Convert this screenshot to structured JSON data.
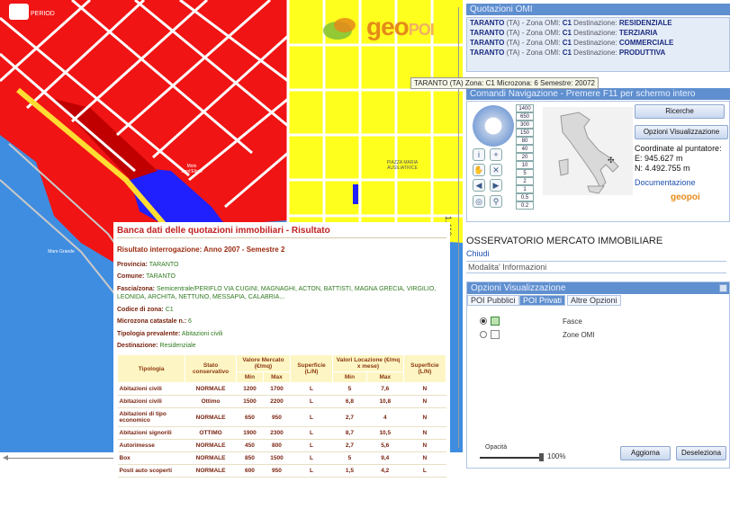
{
  "map": {
    "label_sea": "Mare Grande",
    "label_square": "PIAZZA MARIA AUSILIATRICE",
    "label_street": "Molo Sant'Eligio",
    "topleft_text": "PERIOD"
  },
  "logo": {
    "main": "geo",
    "suffix": "POI"
  },
  "scale_text": "1.410 m",
  "result": {
    "title": "Banca dati delle quotazioni immobiliari - Risultato",
    "subtitle": "Risultato interrogazione: Anno 2007 - Semestre 2",
    "fields": [
      {
        "label": "Provincia:",
        "value": "TARANTO"
      },
      {
        "label": "Comune:",
        "value": "TARANTO"
      },
      {
        "label": "Fascia/zona:",
        "value": "Semicentrale/PERIFLO VIA CUGINI, MAGNAGHI, ACTON, BATTISTI, MAGNA GRECIA, VIRGILIO, LEONIDA, ARCHITA, NETTUNO, MESSAPIA, CALABRIA..."
      },
      {
        "label": "Codice di zona:",
        "value": "C1"
      },
      {
        "label": "Microzona catastale n.:",
        "value": "6"
      },
      {
        "label": "Tipologia prevalente:",
        "value": "Abitazioni civili"
      },
      {
        "label": "Destinazione:",
        "value": "Residenziale"
      }
    ],
    "table": {
      "headers": {
        "tipologia": "Tipologia",
        "stato": "Stato conservativo",
        "valore_mercato": "Valore Mercato (€/mq)",
        "sup1": "Superficie (L/N)",
        "valori_locazione": "Valori Locazione (€/mq x mese)",
        "sup2": "Superficie (L/N)",
        "min": "Min",
        "max": "Max"
      },
      "rows": [
        {
          "tipologia": "Abitazioni civili",
          "stato": "NORMALE",
          "vmin": "1200",
          "vmax": "1700",
          "s1": "L",
          "lmin": "5",
          "lmax": "7,6",
          "s2": "N"
        },
        {
          "tipologia": "Abitazioni civili",
          "stato": "Ottimo",
          "vmin": "1500",
          "vmax": "2200",
          "s1": "L",
          "lmin": "6,8",
          "lmax": "10,8",
          "s2": "N"
        },
        {
          "tipologia": "Abitazioni di tipo economico",
          "stato": "NORMALE",
          "vmin": "650",
          "vmax": "950",
          "s1": "L",
          "lmin": "2,7",
          "lmax": "4",
          "s2": "N"
        },
        {
          "tipologia": "Abitazioni signorili",
          "stato": "OTTIMO",
          "vmin": "1900",
          "vmax": "2300",
          "s1": "L",
          "lmin": "8,7",
          "lmax": "10,5",
          "s2": "N"
        },
        {
          "tipologia": "Autorimesse",
          "stato": "NORMALE",
          "vmin": "450",
          "vmax": "800",
          "s1": "L",
          "lmin": "2,7",
          "lmax": "5,6",
          "s2": "N"
        },
        {
          "tipologia": "Box",
          "stato": "NORMALE",
          "vmin": "850",
          "vmax": "1500",
          "s1": "L",
          "lmin": "5",
          "lmax": "9,4",
          "s2": "N"
        },
        {
          "tipologia": "Posti auto scoperti",
          "stato": "NORMALE",
          "vmin": "600",
          "vmax": "950",
          "s1": "L",
          "lmin": "1,5",
          "lmax": "4,2",
          "s2": "L"
        }
      ]
    }
  },
  "omi": {
    "title": "Quotazioni OMI",
    "lines": [
      {
        "city": "TARANTO",
        "prov": "(TA) - Zona OMI:",
        "zona": "C1",
        "dest_label": "Destinazione:",
        "dest": "RESIDENZIALE"
      },
      {
        "city": "TARANTO",
        "prov": "(TA) - Zona OMI:",
        "zona": "C1",
        "dest_label": "Destinazione:",
        "dest": "TERZIARIA"
      },
      {
        "city": "TARANTO",
        "prov": "(TA) - Zona OMI:",
        "zona": "C1",
        "dest_label": "Destinazione:",
        "dest": "COMMERCIALE"
      },
      {
        "city": "TARANTO",
        "prov": "(TA) - Zona OMI:",
        "zona": "C1",
        "dest_label": "Destinazione:",
        "dest": "PRODUTTIVA"
      }
    ]
  },
  "tooltip": "TARANTO (TA) Zona: C1 Microzona: 6 Semestre: 20072",
  "nav": {
    "title": "Comandi Navigazione - Premere F11 per schermo intero",
    "scales": [
      "1400",
      "650",
      "300",
      "150",
      "80",
      "40",
      "20",
      "10",
      "5",
      "2",
      "1",
      "0.5",
      "0.2"
    ],
    "btn_ricerche": "Ricerche",
    "btn_opzioni": "Opzioni Visualizzazione",
    "coord_title": "Coordinate al puntatore:",
    "coord_e": "E: 945.627 m",
    "coord_n": "N: 4.492.755 m",
    "doc_link": "Documentazione",
    "logo_small": "geopoi"
  },
  "osservatorio": "OSSERVATORIO MERCATO IMMOBILIARE",
  "chiudi": "Chiudi",
  "modalita": "Modalita' Informazioni",
  "opzioni": {
    "title": "Opzioni Visualizzazione",
    "tabs": [
      "POI Pubblici",
      "POI Privati",
      "Altre Opzioni"
    ],
    "layers": [
      {
        "name": "Fasce",
        "checked": true
      },
      {
        "name": "Zone OMI",
        "checked": false
      }
    ],
    "opacity_label": "Opacità",
    "opacity_value": "100%",
    "btn_aggiorna": "Aggiorna",
    "btn_deseleziona": "Deseleziona"
  },
  "colors": {
    "sea": "#3f8de0",
    "red_zone": "#f01414",
    "yellow_zone": "#ffff1e",
    "blue_zone": "#2020ff",
    "panel_title": "#5f8fcf"
  }
}
